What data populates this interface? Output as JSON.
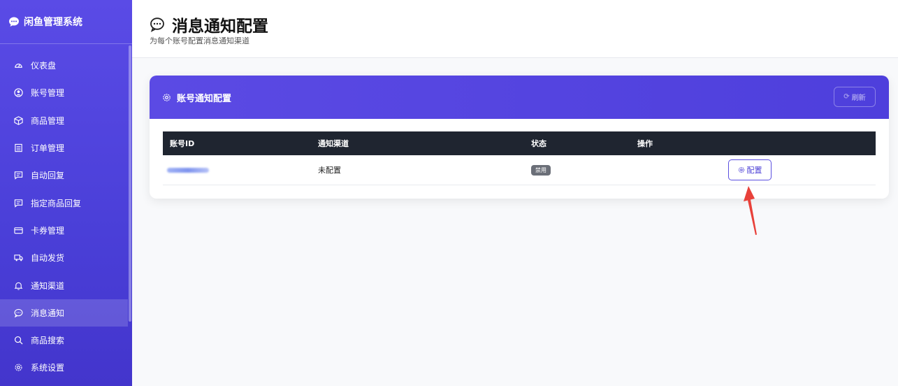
{
  "app": {
    "title": "闲鱼管理系统"
  },
  "sidebar": {
    "items": [
      {
        "label": "仪表盘",
        "icon": "dashboard-icon"
      },
      {
        "label": "账号管理",
        "icon": "user-icon"
      },
      {
        "label": "商品管理",
        "icon": "box-icon"
      },
      {
        "label": "订单管理",
        "icon": "order-icon"
      },
      {
        "label": "自动回复",
        "icon": "chat-icon"
      },
      {
        "label": "指定商品回复",
        "icon": "chat-icon"
      },
      {
        "label": "卡券管理",
        "icon": "card-icon"
      },
      {
        "label": "自动发货",
        "icon": "truck-icon"
      },
      {
        "label": "通知渠道",
        "icon": "bell-icon"
      },
      {
        "label": "消息通知",
        "icon": "message-icon",
        "active": true
      },
      {
        "label": "商品搜索",
        "icon": "search-icon"
      },
      {
        "label": "系统设置",
        "icon": "gear-icon"
      }
    ]
  },
  "header": {
    "title": "消息通知配置",
    "subtitle": "为每个账号配置消息通知渠道"
  },
  "card": {
    "title": "账号通知配置",
    "refresh_label": "刷新",
    "table": {
      "headers": [
        "账号ID",
        "通知渠道",
        "状态",
        "操作"
      ],
      "rows": [
        {
          "channel": "未配置",
          "status": "禁用",
          "action": "配置"
        }
      ]
    }
  },
  "colors": {
    "sidebar": "#4a3fd8",
    "header_card": "#5b4ae4",
    "table_header": "#1f2530",
    "annotation_arrow": "#e8413a"
  }
}
